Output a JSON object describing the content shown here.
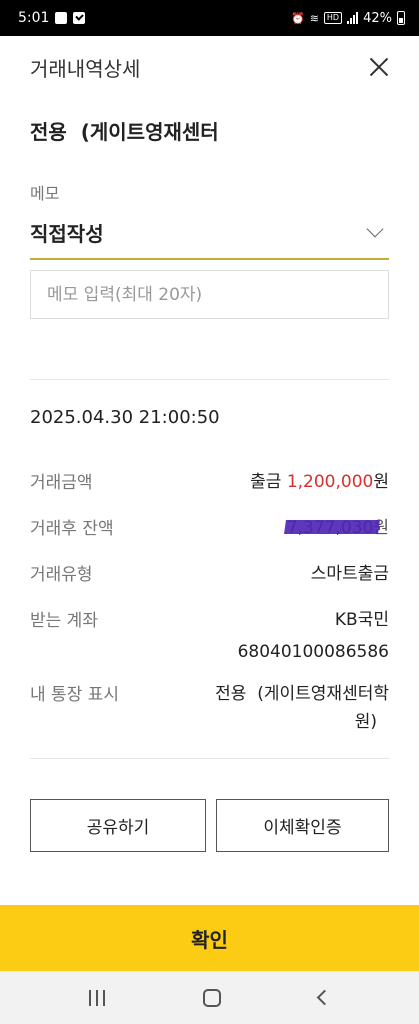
{
  "status_bar": {
    "time": "5:01",
    "battery": "42%"
  },
  "header": {
    "title": "거래내역상세"
  },
  "recipient": "전용  (게이트영재센터",
  "memo": {
    "label": "메모",
    "selected": "직접작성",
    "placeholder": "메모 입력(최대 20자)"
  },
  "datetime": "2025.04.30 21:00:50",
  "details": {
    "amount": {
      "label": "거래금액",
      "prefix": "출금",
      "value": "1,200,000",
      "unit": "원"
    },
    "balance": {
      "label": "거래후 잔액",
      "value": "7,377,030",
      "unit": "원"
    },
    "type": {
      "label": "거래유형",
      "value": "스마트출금"
    },
    "account": {
      "label": "받는 계좌",
      "bank": "KB국민",
      "number": "68040100086586"
    },
    "passbook": {
      "label": "내 통장 표시",
      "line1": "전용  (게이트영재센터학",
      "line2": "원)"
    }
  },
  "buttons": {
    "share": "공유하기",
    "transfer_cert": "이체확인증",
    "confirm": "확인"
  },
  "colors": {
    "accent": "#fccc14",
    "amount": "#d92f2f",
    "underline": "#c8ad3a"
  },
  "icons": {
    "close": "close-icon",
    "dropdown": "chevron-down-icon"
  }
}
